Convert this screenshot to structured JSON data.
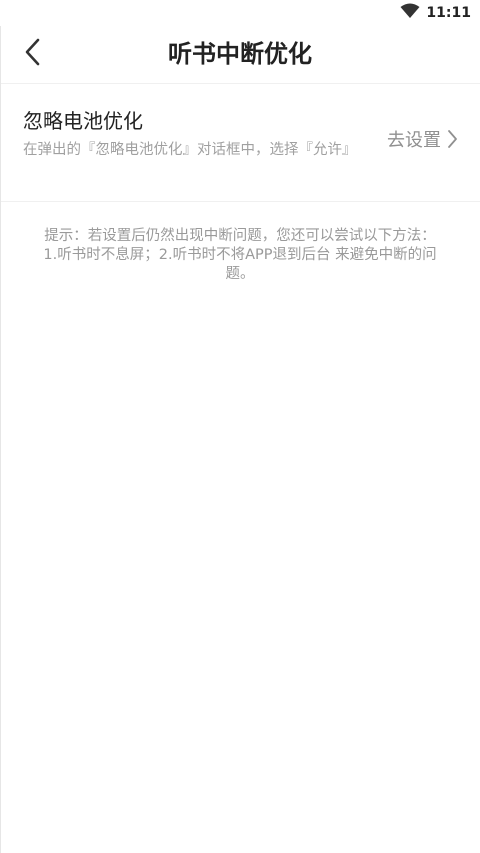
{
  "status_bar": {
    "time": "11:11",
    "wifi_icon": "wifi-icon"
  },
  "nav": {
    "back_icon": "chevron-left-icon",
    "title": "听书中断优化"
  },
  "setting": {
    "title": "忽略电池优化",
    "description": "在弹出的『忽略电池优化』对话框中，选择『允许』",
    "action_label": "去设置",
    "action_icon": "chevron-right-icon"
  },
  "tip": {
    "line1": "提示：若设置后仍然出现中断问题，您还可以尝试以下方法：",
    "line2": "1.听书时不息屏；2.听书时不将APP退到后台 来避免中断的问",
    "line3": "题。"
  },
  "colors": {
    "background": "#ffffff",
    "title_text": "#222222",
    "secondary_text": "#a0a0a0",
    "action_text": "#909090",
    "divider": "#f0f0f0"
  }
}
